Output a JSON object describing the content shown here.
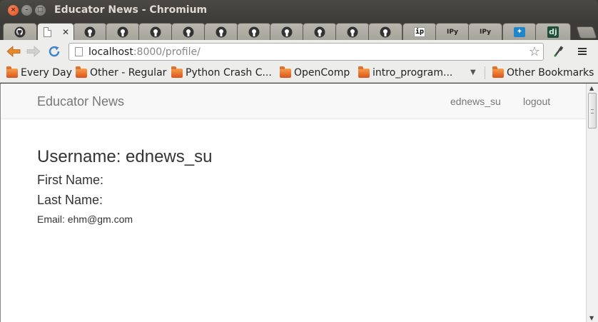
{
  "window": {
    "title": "Educator News - Chromium"
  },
  "tabs": [
    {
      "icon": "github-icon"
    },
    {
      "icon": "page-icon",
      "active": true
    },
    {
      "icon": "github-icon"
    },
    {
      "icon": "github-icon"
    },
    {
      "icon": "github-icon"
    },
    {
      "icon": "github-icon"
    },
    {
      "icon": "github-icon"
    },
    {
      "icon": "github-icon"
    },
    {
      "icon": "github-icon"
    },
    {
      "icon": "github-icon"
    },
    {
      "icon": "github-icon"
    },
    {
      "icon": "github-icon"
    },
    {
      "icon": "ip-icon",
      "label": "ip"
    },
    {
      "icon": "ipython-icon",
      "label": "IPy"
    },
    {
      "icon": "ipython-icon",
      "label": "IPy"
    },
    {
      "icon": "twitter-icon"
    },
    {
      "icon": "django-icon",
      "label": "dj"
    }
  ],
  "toolbar": {
    "url_host": "localhost",
    "url_rest": ":8000/profile/"
  },
  "bookmarks": [
    {
      "label": "Every Day"
    },
    {
      "label": "Other - Regular"
    },
    {
      "label": "Python Crash C..."
    },
    {
      "label": "OpenComp"
    },
    {
      "label": "intro_program..."
    }
  ],
  "bookmarks_other": "Other Bookmarks",
  "page": {
    "brand": "Educator News",
    "nav_user": "ednews_su",
    "nav_logout": "logout",
    "username_line": "Username: ednews_su",
    "first_name_line": "First Name:",
    "last_name_line": "Last Name:",
    "email_line": "Email: ehm@gm.com"
  },
  "colors": {
    "accent_orange": "#e0481e",
    "titlebar": "#3c3b37",
    "link_blue": "#1f87c9"
  }
}
